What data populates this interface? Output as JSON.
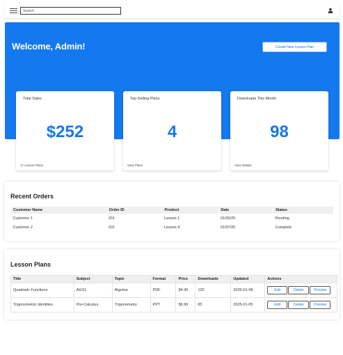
{
  "search": {
    "placeholder": "Search"
  },
  "header": {
    "welcome": "Welcome, Admin!",
    "create_button": "Create New Lesson Plan"
  },
  "stats": [
    {
      "label": "Total Sales",
      "value": "$252",
      "link": "17 Lesson Plans"
    },
    {
      "label": "Top-Selling Plans",
      "value": "4",
      "link": "View Plans"
    },
    {
      "label": "Downloads This Month",
      "value": "98",
      "link": "View Details"
    }
  ],
  "orders": {
    "title": "Recent Orders",
    "columns": [
      "Customer Name",
      "Order ID",
      "Product",
      "Date",
      "Status"
    ],
    "rows": [
      [
        "Customer 1",
        "ID1",
        "Lesson 1",
        "01/05/25",
        "Pending"
      ],
      [
        "Customer 2",
        "ID2",
        "Lesson 4",
        "01/07/25",
        "Complete"
      ]
    ]
  },
  "lesson_plans": {
    "title": "Lesson Plans",
    "columns": [
      "Title",
      "Subject",
      "Topic",
      "Format",
      "Price",
      "Downloads",
      "Updated",
      "Actions"
    ],
    "rows": [
      [
        "Quadratic Functions",
        "AGS1",
        "Algebra",
        "PDF",
        "$4.99",
        "120",
        "2025-01-08"
      ],
      [
        "Trigonometric Identities",
        "Pre-Calculus",
        "Trigonometry",
        "PPT",
        "$6.99",
        "85",
        "2025-01-05"
      ]
    ],
    "actions": [
      "Edit",
      "Delete",
      "Preview"
    ]
  }
}
